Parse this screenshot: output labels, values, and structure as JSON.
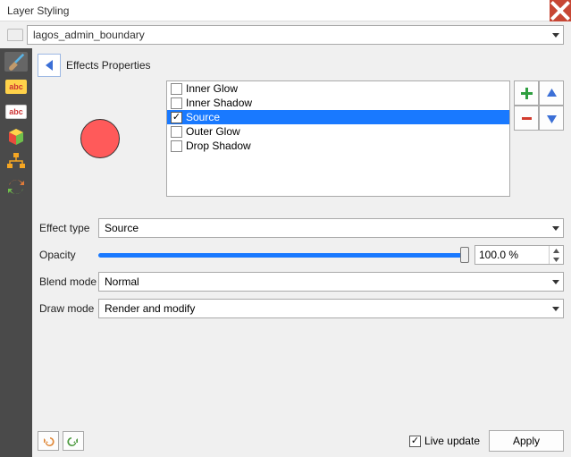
{
  "window": {
    "title": "Layer Styling"
  },
  "layer": {
    "name": "lagos_admin_boundary"
  },
  "header": {
    "label": "Effects Properties"
  },
  "sidebar": {
    "items": [
      "brush",
      "labels-yellow",
      "labels-white",
      "3d",
      "diagram",
      "refresh"
    ]
  },
  "preview": {
    "fill": "#ff5a5a",
    "stroke": "#333333"
  },
  "effects": [
    {
      "label": "Inner Glow",
      "checked": false,
      "selected": false
    },
    {
      "label": "Inner Shadow",
      "checked": false,
      "selected": false
    },
    {
      "label": "Source",
      "checked": true,
      "selected": true
    },
    {
      "label": "Outer Glow",
      "checked": false,
      "selected": false
    },
    {
      "label": "Drop Shadow",
      "checked": false,
      "selected": false
    }
  ],
  "effect_type": {
    "label": "Effect type",
    "value": "Source"
  },
  "opacity": {
    "label": "Opacity",
    "value": "100.0 %",
    "percent": 100
  },
  "blend_mode": {
    "label": "Blend mode",
    "value": "Normal"
  },
  "draw_mode": {
    "label": "Draw mode",
    "value": "Render and modify"
  },
  "footer": {
    "live_update_label": "Live update",
    "live_update_checked": true,
    "apply_label": "Apply"
  }
}
